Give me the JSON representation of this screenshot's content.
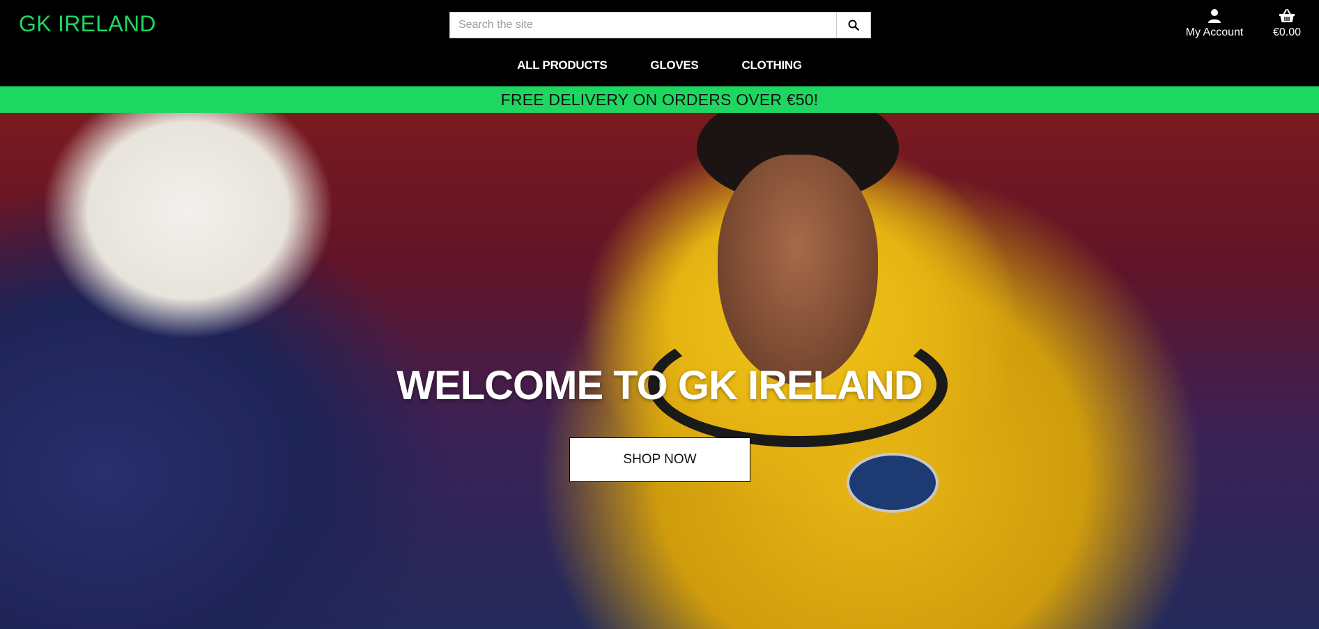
{
  "header": {
    "logo": "GK IRELAND",
    "search": {
      "placeholder": "Search the site",
      "icon": "search-icon"
    },
    "account": {
      "label": "My Account",
      "icon": "user-icon"
    },
    "basket": {
      "label": "€0.00",
      "icon": "basket-icon"
    }
  },
  "nav": {
    "items": [
      {
        "label": "ALL PRODUCTS"
      },
      {
        "label": "GLOVES"
      },
      {
        "label": "CLOTHING"
      }
    ]
  },
  "banner": {
    "text": "FREE DELIVERY ON ORDERS OVER €50!"
  },
  "hero": {
    "title": "WELCOME TO GK IRELAND",
    "cta": "SHOP NOW"
  },
  "colors": {
    "brand": "#1ed760",
    "header_bg": "#000000",
    "banner_bg": "#1ed760"
  }
}
